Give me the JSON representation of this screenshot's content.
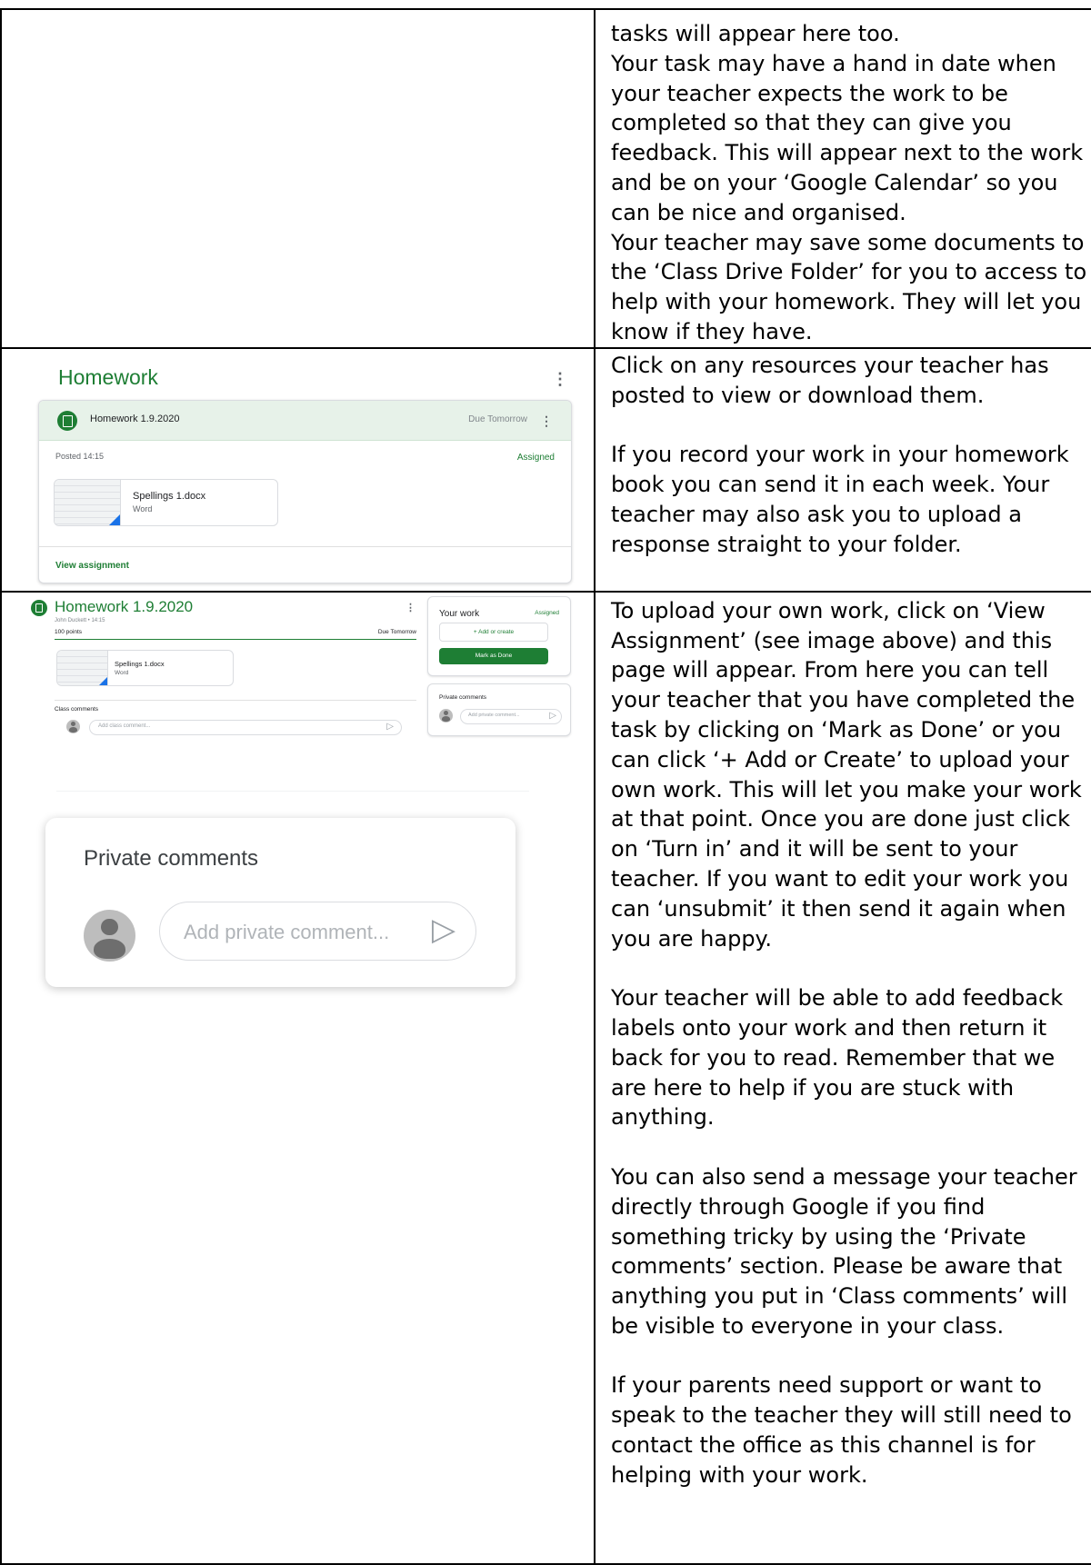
{
  "rows": [
    {
      "right_text": [
        "tasks will appear here too.",
        "Your task may have a hand in date when your teacher expects the work to be completed so that they can give you feedback. This will appear next to the work and be on your ‘Google Calendar’ so you can be nice and organised.",
        "Your teacher may save some documents to the ‘Class Drive Folder’ for you to access to help with your homework. They will let you know if they have."
      ]
    },
    {
      "right_text": [
        "Click on any resources your teacher has posted to view or download them.",
        "",
        "If you record your work in your homework book you can send it in each week. Your teacher may also ask you to upload a response straight to your folder."
      ]
    },
    {
      "right_text": [
        "To upload your own work, click on ‘View Assignment’ (see image above) and this page will appear. From here you can tell your teacher that you have completed the task by clicking on ‘Mark as Done’ or you can click ‘+ Add or Create’ to upload your own work. This will let you make your work at that point. Once you are done just click on ‘Turn in’ and it will be sent to your teacher. If you want to edit your work you can ‘unsubmit’ it then send it again when you are happy.",
        "",
        "Your teacher will be able to add feedback labels onto your work and then return it back for you to read. Remember that we are here to help if you are stuck with anything.",
        "",
        "You can also send a message your teacher directly through Google if you find something tricky by using the ‘Private comments’ section. Please be aware that anything you put in ‘Class comments’ will be visible to everyone in your class.",
        "",
        "If your parents need support or want to speak to the teacher they will still need to contact the office as this channel is for helping with your work."
      ]
    }
  ],
  "homework_card": {
    "heading": "Homework",
    "assignment_title": "Homework 1.9.2020",
    "due": "Due Tomorrow",
    "posted": "Posted 14:15",
    "status": "Assigned",
    "file_name": "Spellings 1.docx",
    "file_type": "Word",
    "view_link": "View assignment"
  },
  "assignment_page": {
    "title": "Homework 1.9.2020",
    "author_time": "John Duckett • 14:15",
    "points": "100 points",
    "due": "Due Tomorrow",
    "file_name": "Spellings 1.docx",
    "file_type": "Word",
    "class_comments_label": "Class comments",
    "class_comment_placeholder": "Add class comment...",
    "your_work_title": "Your work",
    "your_work_status": "Assigned",
    "add_or_create": "+ Add or create",
    "mark_as_done": "Mark as Done",
    "private_comments_label": "Private comments",
    "private_comment_placeholder": "Add private comment..."
  },
  "private_comments_zoom": {
    "title": "Private comments",
    "placeholder": "Add private comment..."
  },
  "colors": {
    "classroom_green": "#1e7e34",
    "header_tint": "#e7f2e9",
    "file_corner_blue": "#1a73e8"
  },
  "icons": [
    "assignment-icon",
    "more-vert-icon",
    "send-icon",
    "avatar-icon",
    "word-file-icon"
  ]
}
